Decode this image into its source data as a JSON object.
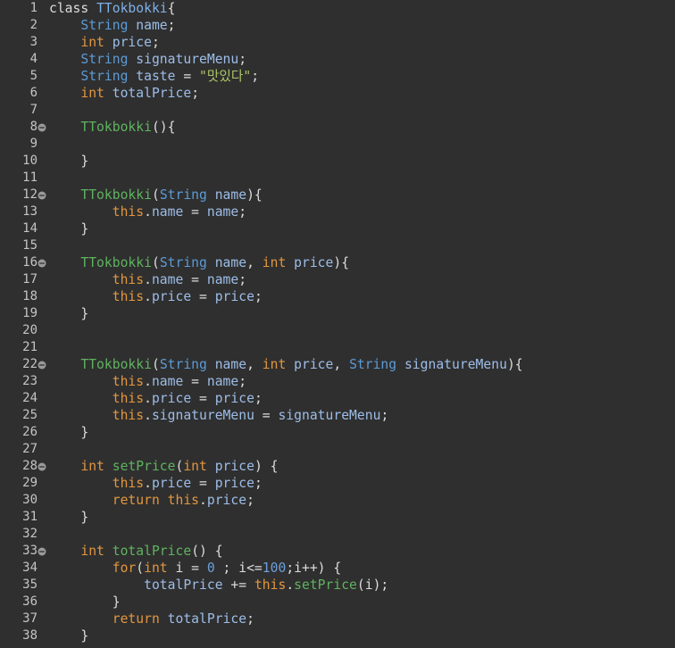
{
  "colors": {
    "background": "#2f2f2f",
    "gutter_text": "#c4c4c4",
    "fold_marker": "#9a9a9a",
    "plain": "#dcdcdc",
    "keyword": "#e2963f",
    "type": "#5c9bd6",
    "class_name": "#7fb0e6",
    "field": "#9dbde8",
    "method": "#5fb35f",
    "string": "#a9c465",
    "number": "#6c9fdb"
  },
  "editor": {
    "lines": [
      {
        "n": "1",
        "fold": false,
        "tokens": [
          {
            "t": "class",
            "c": "plain"
          },
          {
            "t": " ",
            "c": "plain"
          },
          {
            "t": "TTokbokki",
            "c": "class_name"
          },
          {
            "t": "{",
            "c": "plain"
          }
        ]
      },
      {
        "n": "2",
        "fold": false,
        "tokens": [
          {
            "t": "    ",
            "c": "plain"
          },
          {
            "t": "String",
            "c": "type"
          },
          {
            "t": " ",
            "c": "plain"
          },
          {
            "t": "name",
            "c": "field"
          },
          {
            "t": ";",
            "c": "plain"
          }
        ]
      },
      {
        "n": "3",
        "fold": false,
        "tokens": [
          {
            "t": "    ",
            "c": "plain"
          },
          {
            "t": "int",
            "c": "keyword"
          },
          {
            "t": " ",
            "c": "plain"
          },
          {
            "t": "price",
            "c": "field"
          },
          {
            "t": ";",
            "c": "plain"
          }
        ]
      },
      {
        "n": "4",
        "fold": false,
        "tokens": [
          {
            "t": "    ",
            "c": "plain"
          },
          {
            "t": "String",
            "c": "type"
          },
          {
            "t": " ",
            "c": "plain"
          },
          {
            "t": "signatureMenu",
            "c": "field"
          },
          {
            "t": ";",
            "c": "plain"
          }
        ]
      },
      {
        "n": "5",
        "fold": false,
        "tokens": [
          {
            "t": "    ",
            "c": "plain"
          },
          {
            "t": "String",
            "c": "type"
          },
          {
            "t": " ",
            "c": "plain"
          },
          {
            "t": "taste",
            "c": "field"
          },
          {
            "t": " = ",
            "c": "plain"
          },
          {
            "t": "\"맛있다\"",
            "c": "string"
          },
          {
            "t": ";",
            "c": "plain"
          }
        ]
      },
      {
        "n": "6",
        "fold": false,
        "tokens": [
          {
            "t": "    ",
            "c": "plain"
          },
          {
            "t": "int",
            "c": "keyword"
          },
          {
            "t": " ",
            "c": "plain"
          },
          {
            "t": "totalPrice",
            "c": "field"
          },
          {
            "t": ";",
            "c": "plain"
          }
        ]
      },
      {
        "n": "7",
        "fold": false,
        "tokens": []
      },
      {
        "n": "8",
        "fold": true,
        "tokens": [
          {
            "t": "    ",
            "c": "plain"
          },
          {
            "t": "TTokbokki",
            "c": "method"
          },
          {
            "t": "(){",
            "c": "plain"
          }
        ]
      },
      {
        "n": "9",
        "fold": false,
        "tokens": []
      },
      {
        "n": "10",
        "fold": false,
        "tokens": [
          {
            "t": "    }",
            "c": "plain"
          }
        ]
      },
      {
        "n": "11",
        "fold": false,
        "tokens": []
      },
      {
        "n": "12",
        "fold": true,
        "tokens": [
          {
            "t": "    ",
            "c": "plain"
          },
          {
            "t": "TTokbokki",
            "c": "method"
          },
          {
            "t": "(",
            "c": "plain"
          },
          {
            "t": "String",
            "c": "type"
          },
          {
            "t": " ",
            "c": "plain"
          },
          {
            "t": "name",
            "c": "field"
          },
          {
            "t": "){",
            "c": "plain"
          }
        ]
      },
      {
        "n": "13",
        "fold": false,
        "tokens": [
          {
            "t": "        ",
            "c": "plain"
          },
          {
            "t": "this",
            "c": "keyword"
          },
          {
            "t": ".",
            "c": "plain"
          },
          {
            "t": "name",
            "c": "field"
          },
          {
            "t": " = ",
            "c": "plain"
          },
          {
            "t": "name",
            "c": "field"
          },
          {
            "t": ";",
            "c": "plain"
          }
        ]
      },
      {
        "n": "14",
        "fold": false,
        "tokens": [
          {
            "t": "    }",
            "c": "plain"
          }
        ]
      },
      {
        "n": "15",
        "fold": false,
        "tokens": []
      },
      {
        "n": "16",
        "fold": true,
        "tokens": [
          {
            "t": "    ",
            "c": "plain"
          },
          {
            "t": "TTokbokki",
            "c": "method"
          },
          {
            "t": "(",
            "c": "plain"
          },
          {
            "t": "String",
            "c": "type"
          },
          {
            "t": " ",
            "c": "plain"
          },
          {
            "t": "name",
            "c": "field"
          },
          {
            "t": ", ",
            "c": "plain"
          },
          {
            "t": "int",
            "c": "keyword"
          },
          {
            "t": " ",
            "c": "plain"
          },
          {
            "t": "price",
            "c": "field"
          },
          {
            "t": "){",
            "c": "plain"
          }
        ]
      },
      {
        "n": "17",
        "fold": false,
        "tokens": [
          {
            "t": "        ",
            "c": "plain"
          },
          {
            "t": "this",
            "c": "keyword"
          },
          {
            "t": ".",
            "c": "plain"
          },
          {
            "t": "name",
            "c": "field"
          },
          {
            "t": " = ",
            "c": "plain"
          },
          {
            "t": "name",
            "c": "field"
          },
          {
            "t": ";",
            "c": "plain"
          }
        ]
      },
      {
        "n": "18",
        "fold": false,
        "tokens": [
          {
            "t": "        ",
            "c": "plain"
          },
          {
            "t": "this",
            "c": "keyword"
          },
          {
            "t": ".",
            "c": "plain"
          },
          {
            "t": "price",
            "c": "field"
          },
          {
            "t": " = ",
            "c": "plain"
          },
          {
            "t": "price",
            "c": "field"
          },
          {
            "t": ";",
            "c": "plain"
          }
        ]
      },
      {
        "n": "19",
        "fold": false,
        "tokens": [
          {
            "t": "    }",
            "c": "plain"
          }
        ]
      },
      {
        "n": "20",
        "fold": false,
        "tokens": []
      },
      {
        "n": "21",
        "fold": false,
        "tokens": []
      },
      {
        "n": "22",
        "fold": true,
        "tokens": [
          {
            "t": "    ",
            "c": "plain"
          },
          {
            "t": "TTokbokki",
            "c": "method"
          },
          {
            "t": "(",
            "c": "plain"
          },
          {
            "t": "String",
            "c": "type"
          },
          {
            "t": " ",
            "c": "plain"
          },
          {
            "t": "name",
            "c": "field"
          },
          {
            "t": ", ",
            "c": "plain"
          },
          {
            "t": "int",
            "c": "keyword"
          },
          {
            "t": " ",
            "c": "plain"
          },
          {
            "t": "price",
            "c": "field"
          },
          {
            "t": ", ",
            "c": "plain"
          },
          {
            "t": "String",
            "c": "type"
          },
          {
            "t": " ",
            "c": "plain"
          },
          {
            "t": "signatureMenu",
            "c": "field"
          },
          {
            "t": "){",
            "c": "plain"
          }
        ]
      },
      {
        "n": "23",
        "fold": false,
        "tokens": [
          {
            "t": "        ",
            "c": "plain"
          },
          {
            "t": "this",
            "c": "keyword"
          },
          {
            "t": ".",
            "c": "plain"
          },
          {
            "t": "name",
            "c": "field"
          },
          {
            "t": " = ",
            "c": "plain"
          },
          {
            "t": "name",
            "c": "field"
          },
          {
            "t": ";",
            "c": "plain"
          }
        ]
      },
      {
        "n": "24",
        "fold": false,
        "tokens": [
          {
            "t": "        ",
            "c": "plain"
          },
          {
            "t": "this",
            "c": "keyword"
          },
          {
            "t": ".",
            "c": "plain"
          },
          {
            "t": "price",
            "c": "field"
          },
          {
            "t": " = ",
            "c": "plain"
          },
          {
            "t": "price",
            "c": "field"
          },
          {
            "t": ";",
            "c": "plain"
          }
        ]
      },
      {
        "n": "25",
        "fold": false,
        "tokens": [
          {
            "t": "        ",
            "c": "plain"
          },
          {
            "t": "this",
            "c": "keyword"
          },
          {
            "t": ".",
            "c": "plain"
          },
          {
            "t": "signatureMenu",
            "c": "field"
          },
          {
            "t": " = ",
            "c": "plain"
          },
          {
            "t": "signatureMenu",
            "c": "field"
          },
          {
            "t": ";",
            "c": "plain"
          }
        ]
      },
      {
        "n": "26",
        "fold": false,
        "tokens": [
          {
            "t": "    }",
            "c": "plain"
          }
        ]
      },
      {
        "n": "27",
        "fold": false,
        "tokens": []
      },
      {
        "n": "28",
        "fold": true,
        "tokens": [
          {
            "t": "    ",
            "c": "plain"
          },
          {
            "t": "int",
            "c": "keyword"
          },
          {
            "t": " ",
            "c": "plain"
          },
          {
            "t": "setPrice",
            "c": "method"
          },
          {
            "t": "(",
            "c": "plain"
          },
          {
            "t": "int",
            "c": "keyword"
          },
          {
            "t": " ",
            "c": "plain"
          },
          {
            "t": "price",
            "c": "field"
          },
          {
            "t": ") {",
            "c": "plain"
          }
        ]
      },
      {
        "n": "29",
        "fold": false,
        "tokens": [
          {
            "t": "        ",
            "c": "plain"
          },
          {
            "t": "this",
            "c": "keyword"
          },
          {
            "t": ".",
            "c": "plain"
          },
          {
            "t": "price",
            "c": "field"
          },
          {
            "t": " = ",
            "c": "plain"
          },
          {
            "t": "price",
            "c": "field"
          },
          {
            "t": ";",
            "c": "plain"
          }
        ]
      },
      {
        "n": "30",
        "fold": false,
        "tokens": [
          {
            "t": "        ",
            "c": "plain"
          },
          {
            "t": "return",
            "c": "keyword"
          },
          {
            "t": " ",
            "c": "plain"
          },
          {
            "t": "this",
            "c": "keyword"
          },
          {
            "t": ".",
            "c": "plain"
          },
          {
            "t": "price",
            "c": "field"
          },
          {
            "t": ";",
            "c": "plain"
          }
        ]
      },
      {
        "n": "31",
        "fold": false,
        "tokens": [
          {
            "t": "    }",
            "c": "plain"
          }
        ]
      },
      {
        "n": "32",
        "fold": false,
        "tokens": []
      },
      {
        "n": "33",
        "fold": true,
        "tokens": [
          {
            "t": "    ",
            "c": "plain"
          },
          {
            "t": "int",
            "c": "keyword"
          },
          {
            "t": " ",
            "c": "plain"
          },
          {
            "t": "totalPrice",
            "c": "method"
          },
          {
            "t": "() {",
            "c": "plain"
          }
        ]
      },
      {
        "n": "34",
        "fold": false,
        "tokens": [
          {
            "t": "        ",
            "c": "plain"
          },
          {
            "t": "for",
            "c": "keyword"
          },
          {
            "t": "(",
            "c": "plain"
          },
          {
            "t": "int",
            "c": "keyword"
          },
          {
            "t": " i = ",
            "c": "plain"
          },
          {
            "t": "0",
            "c": "number"
          },
          {
            "t": " ; i<=",
            "c": "plain"
          },
          {
            "t": "100",
            "c": "number"
          },
          {
            "t": ";i++) {",
            "c": "plain"
          }
        ]
      },
      {
        "n": "35",
        "fold": false,
        "tokens": [
          {
            "t": "            ",
            "c": "plain"
          },
          {
            "t": "totalPrice",
            "c": "field"
          },
          {
            "t": " += ",
            "c": "plain"
          },
          {
            "t": "this",
            "c": "keyword"
          },
          {
            "t": ".",
            "c": "plain"
          },
          {
            "t": "setPrice",
            "c": "method"
          },
          {
            "t": "(i);",
            "c": "plain"
          }
        ]
      },
      {
        "n": "36",
        "fold": false,
        "tokens": [
          {
            "t": "        }",
            "c": "plain"
          }
        ]
      },
      {
        "n": "37",
        "fold": false,
        "tokens": [
          {
            "t": "        ",
            "c": "plain"
          },
          {
            "t": "return",
            "c": "keyword"
          },
          {
            "t": " ",
            "c": "plain"
          },
          {
            "t": "totalPrice",
            "c": "field"
          },
          {
            "t": ";",
            "c": "plain"
          }
        ]
      },
      {
        "n": "38",
        "fold": false,
        "tokens": [
          {
            "t": "    }",
            "c": "plain"
          }
        ]
      }
    ]
  }
}
